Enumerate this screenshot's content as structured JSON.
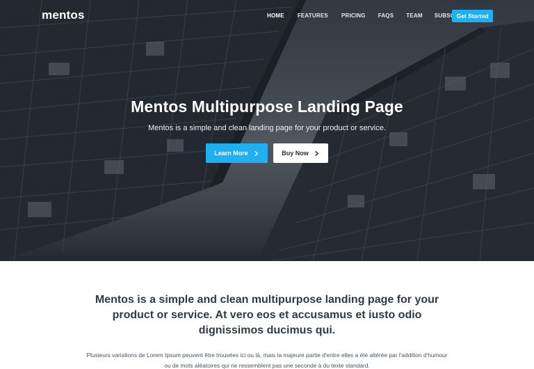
{
  "navbar": {
    "brand": "mentos",
    "links": [
      {
        "label": "Home",
        "active": true
      },
      {
        "label": "Features",
        "active": false
      },
      {
        "label": "Pricing",
        "active": false
      },
      {
        "label": "FAQs",
        "active": false
      },
      {
        "label": "Team",
        "active": false
      },
      {
        "label": "Subscribe",
        "active": false
      }
    ],
    "cta_label": "Get Started"
  },
  "hero": {
    "title": "Mentos Multipurpose Landing Page",
    "subtitle": "Mentos is a simple and clean landing page for your product or service.",
    "primary_button": "Learn More",
    "secondary_button": "Buy Now"
  },
  "intro": {
    "heading": "Mentos is a simple and clean multipurpose landing page for your product or service. At vero eos et accusamus et iusto odio dignissimos ducimus qui.",
    "text": "Plusieurs variations de Lorem Ipsum peuvent être trouvées ici ou là, mais la majeure partie d'entre elles a été altérée par l'addition d'humour ou de mots aléatoires qui ne ressemblent pas une seconde à du texte standard."
  },
  "colors": {
    "accent": "#1eb0f0",
    "heading": "#2f3a48",
    "body_text": "#4a525d"
  },
  "icons": {
    "button_arrow": "chevron-right-icon"
  }
}
